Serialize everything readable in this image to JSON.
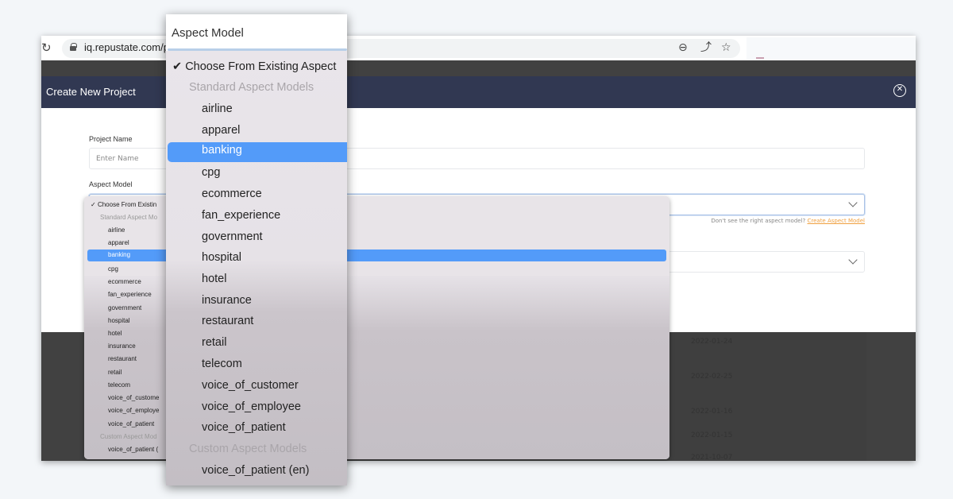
{
  "browser": {
    "url": "iq.repustate.com/p",
    "icons": [
      "reload-icon",
      "lock-icon",
      "zoom-out-icon",
      "share-icon",
      "bookmark-star-icon"
    ]
  },
  "modal": {
    "title": "Create New Project",
    "close_icon": "close-circle-icon",
    "project_name_label": "Project Name",
    "project_name_placeholder": "Enter Name",
    "aspect_model_label": "Aspect Model",
    "hint_text": "Don't see the right aspect model?",
    "hint_link": "Create Aspect Model"
  },
  "background_dates": [
    "2022-01-24",
    "2022-02-25",
    "2022-01-16",
    "2022-01-15",
    "2021-10-07"
  ],
  "dropdown": {
    "title": "Aspect Model",
    "selected_option": "Choose From Existing Aspect",
    "selected_option_short": "Choose From Existin",
    "highlighted": "banking",
    "groups": [
      {
        "label": "Standard Aspect Models",
        "label_short": "Standard Aspect Mo",
        "options": [
          "airline",
          "apparel",
          "banking",
          "cpg",
          "ecommerce",
          "fan_experience",
          "government",
          "hospital",
          "hotel",
          "insurance",
          "restaurant",
          "retail",
          "telecom",
          "voice_of_customer",
          "voice_of_employee",
          "voice_of_patient"
        ],
        "options_short": [
          "airline",
          "apparel",
          "banking",
          "cpg",
          "ecommerce",
          "fan_experience",
          "government",
          "hospital",
          "hotel",
          "insurance",
          "restaurant",
          "retail",
          "telecom",
          "voice_of_custome",
          "voice_of_employe",
          "voice_of_patient"
        ]
      },
      {
        "label": "Custom Aspect Models",
        "label_short": "Custom Aspect Mod",
        "options": [
          "voice_of_patient (en)"
        ],
        "options_short": [
          "voice_of_patient ("
        ]
      }
    ]
  }
}
